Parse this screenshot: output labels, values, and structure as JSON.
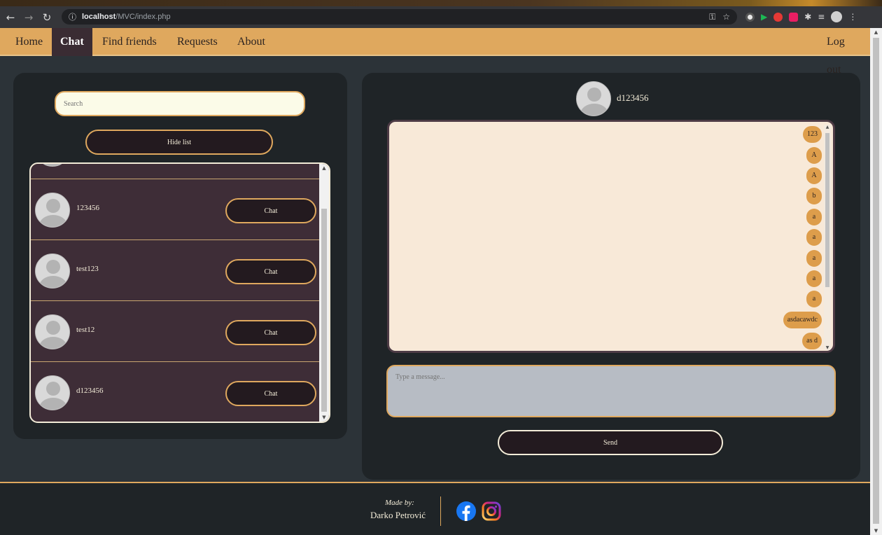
{
  "browser": {
    "url_host": "localhost",
    "url_path": "/MVC/index.php",
    "info_icon": "info-icon",
    "back_icon": "back-arrow-icon",
    "forward_icon": "forward-arrow-icon",
    "reload_icon": "reload-icon",
    "key_icon": "key-icon",
    "star_icon": "star-icon"
  },
  "navbar": {
    "items": [
      {
        "label": "Home",
        "active": false
      },
      {
        "label": "Chat",
        "active": true
      },
      {
        "label": "Find friends",
        "active": false
      },
      {
        "label": "Requests",
        "active": false
      },
      {
        "label": "About",
        "active": false
      }
    ],
    "logout_label": "Log out"
  },
  "sidebar": {
    "search_placeholder": "Search",
    "hide_list_label": "Hide list",
    "friends": [
      {
        "name": "123456",
        "chat_label": "Chat"
      },
      {
        "name": "test123",
        "chat_label": "Chat"
      },
      {
        "name": "test12",
        "chat_label": "Chat"
      },
      {
        "name": "d123456",
        "chat_label": "Chat"
      }
    ]
  },
  "chat": {
    "contact_name": "d123456",
    "messages": [
      "123",
      "A",
      "A",
      "b",
      "a",
      "a",
      "a",
      "a",
      "a",
      "asdacawdc",
      "as d"
    ],
    "input_placeholder": "Type a message...",
    "send_label": "Send"
  },
  "footer": {
    "made_by": "Made by:",
    "author": "Darko Petrović",
    "social_icons": [
      "facebook-icon",
      "instagram-icon"
    ]
  },
  "colors": {
    "accent": "#dfa85e",
    "panel": "#1f2427",
    "list_bg": "#3e2d37",
    "message_bubble": "#dd9d4b",
    "messages_bg": "#f8e9d8"
  }
}
